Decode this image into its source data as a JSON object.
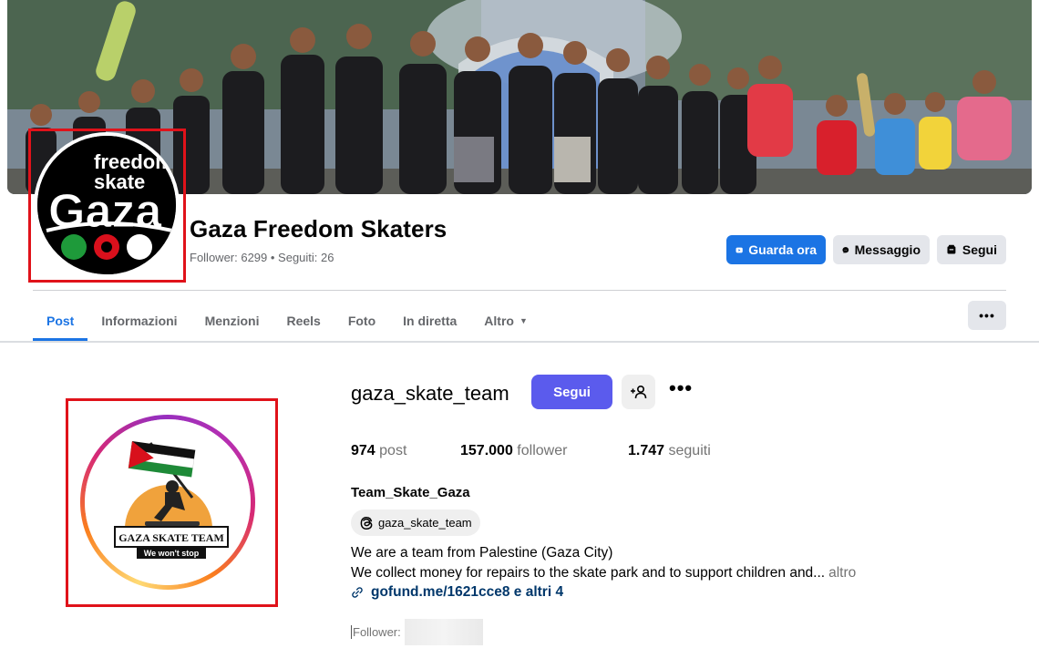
{
  "facebook": {
    "page_name": "Gaza Freedom Skaters",
    "stats": "Follower: 6299 • Seguiti: 26",
    "profile_logo": {
      "line1": "freedom",
      "line2": "skate",
      "line3": "Gaza"
    },
    "buttons": {
      "watch": "Guarda ora",
      "message": "Messaggio",
      "follow": "Segui"
    },
    "tabs": [
      {
        "label": "Post",
        "active": true
      },
      {
        "label": "Informazioni"
      },
      {
        "label": "Menzioni"
      },
      {
        "label": "Reels"
      },
      {
        "label": "Foto"
      },
      {
        "label": "In diretta"
      },
      {
        "label": "Altro"
      }
    ],
    "more_button": "•••",
    "colors": {
      "primary": "#1b74e4",
      "secondary_bg": "#e4e6eb",
      "highlight_box": "#e0121a"
    }
  },
  "instagram": {
    "username": "gaza_skate_team",
    "follow_button": "Segui",
    "options_button": "•••",
    "stats": {
      "posts_value": "974",
      "posts_label": "post",
      "followers_value": "157.000",
      "followers_label": "follower",
      "following_value": "1.747",
      "following_label": "seguiti"
    },
    "full_name": "Team_Skate_Gaza",
    "threads_handle": "gaza_skate_team",
    "bio_line1": "We are a team from Palestine (Gaza City)",
    "bio_line2": "We collect money for repairs to the skate park and to support children and...",
    "bio_more": "altro",
    "link": "gofund.me/1621cce8 e altri 4",
    "followed_by_label": "Follower:",
    "avatar_logo": {
      "badge_title": "GAZA SKATE TEAM",
      "badge_subtitle": "We won't stop"
    },
    "colors": {
      "follow_button": "#5b5bed",
      "link": "#00376b"
    }
  }
}
